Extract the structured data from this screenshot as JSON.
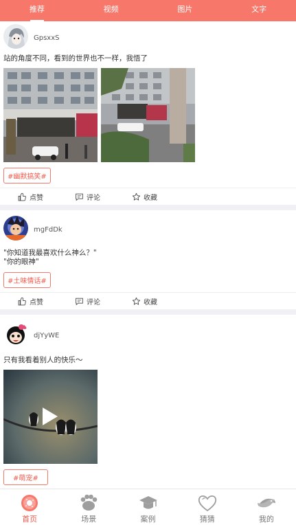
{
  "top_tabs": [
    {
      "label": "推荐",
      "active": true
    },
    {
      "label": "视频",
      "active": false
    },
    {
      "label": "图片",
      "active": false
    },
    {
      "label": "文字",
      "active": false
    }
  ],
  "posts": [
    {
      "username": "GpsxxS",
      "text": "站的角度不同，看到的世界也不一样，我悟了",
      "tag": "#幽默搞笑#",
      "media": "two street photos"
    },
    {
      "username": "mgFdDk",
      "text": "\"你知道我最喜欢什么神么？\"\n\"你的眼神\"",
      "tag": "#土味情话#"
    },
    {
      "username": "djYyWE",
      "text": "只有我看着别人的快乐～",
      "tag": "#萌宠#",
      "media": "video with play button"
    }
  ],
  "actions": {
    "like": "点赞",
    "comment": "评论",
    "collect": "收藏"
  },
  "bottom_nav": [
    {
      "label": "首页",
      "icon": "donut-icon",
      "active": true
    },
    {
      "label": "场景",
      "icon": "paw-icon",
      "active": false
    },
    {
      "label": "案例",
      "icon": "graduation-cap-icon",
      "active": false
    },
    {
      "label": "猜猜",
      "icon": "heart-icon",
      "active": false
    },
    {
      "label": "我的",
      "icon": "fish-icon",
      "active": false
    }
  ],
  "colors": {
    "accent": "#f7776a",
    "tag_text": "#f45a4d"
  }
}
